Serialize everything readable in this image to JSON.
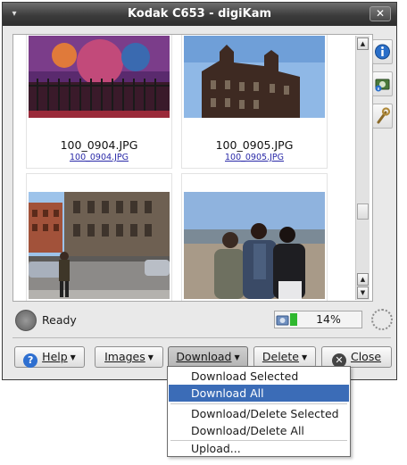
{
  "window": {
    "title": "Kodak C653 - digiKam",
    "close_glyph": "✕",
    "menu_glyph": "▾"
  },
  "thumbnails": [
    {
      "name": "100_0904.JPG",
      "subname": "100_0904.JPG"
    },
    {
      "name": "100_0905.JPG",
      "subname": "100_0905.JPG"
    },
    {
      "name": "",
      "subname": ""
    },
    {
      "name": "",
      "subname": ""
    }
  ],
  "side_buttons": [
    {
      "icon": "info-icon"
    },
    {
      "icon": "camera-info-icon"
    },
    {
      "icon": "wrench-icon"
    }
  ],
  "status": {
    "text": "Ready",
    "progress_percent": 14,
    "progress_label": "14%"
  },
  "buttons": {
    "help": "Help",
    "images": "Images",
    "download": "Download",
    "delete": "Delete",
    "close": "Close"
  },
  "download_menu": {
    "items": [
      "Download Selected",
      "Download All",
      "Download/Delete Selected",
      "Download/Delete All",
      "Upload..."
    ],
    "highlighted_index": 1
  },
  "colors": {
    "menu_highlight": "#3b6cb7",
    "progress_fill": "#2fb82f"
  }
}
